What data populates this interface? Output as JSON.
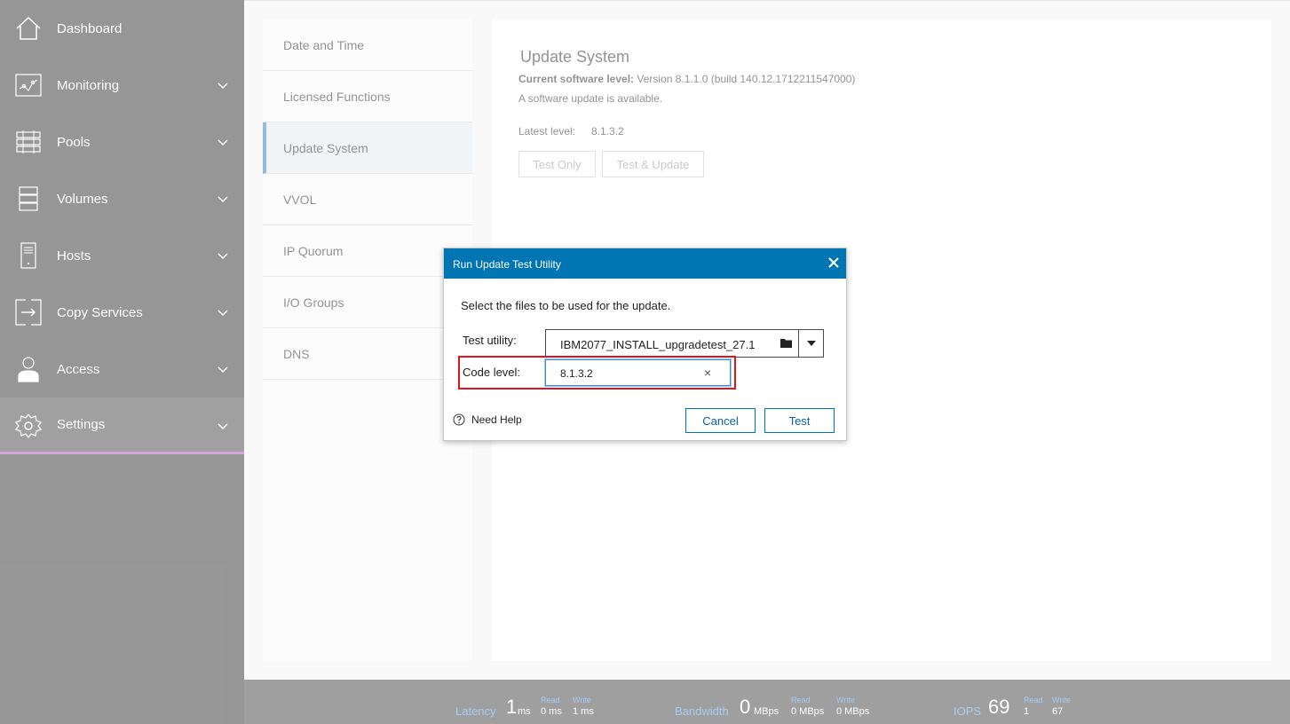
{
  "sidebar": {
    "items": [
      {
        "label": "Dashboard",
        "icon": "home-icon"
      },
      {
        "label": "Monitoring",
        "icon": "monitoring-icon"
      },
      {
        "label": "Pools",
        "icon": "pools-icon"
      },
      {
        "label": "Volumes",
        "icon": "volumes-icon"
      },
      {
        "label": "Hosts",
        "icon": "hosts-icon"
      },
      {
        "label": "Copy Services",
        "icon": "copy-services-icon"
      },
      {
        "label": "Access",
        "icon": "access-icon"
      },
      {
        "label": "Settings",
        "icon": "gear-icon"
      }
    ],
    "active": "Settings"
  },
  "settings_nav": {
    "items": [
      {
        "label": "Date and Time"
      },
      {
        "label": "Licensed Functions"
      },
      {
        "label": "Update System"
      },
      {
        "label": "VVOL"
      },
      {
        "label": "IP Quorum"
      },
      {
        "label": "I/O Groups"
      },
      {
        "label": "DNS"
      }
    ],
    "active": "Update System"
  },
  "update_system": {
    "title": "Update System",
    "current_label": "Current software level:",
    "current_value": "Version 8.1.1.0 (build 140.12.1712211547000)",
    "available_text": "A software update is available.",
    "latest_label": "Latest level:",
    "latest_value": "8.1.3.2",
    "test_only_label": "Test Only",
    "test_update_label": "Test & Update"
  },
  "dialog": {
    "title": "Run Update Test Utility",
    "prompt": "Select the files to be used for the update.",
    "test_utility_label": "Test utility:",
    "test_utility_file": "IBM2077_INSTALL_upgradetest_27.1",
    "code_level_label": "Code level:",
    "code_level_value": "8.1.3.2",
    "clear_symbol": "×",
    "help_text": "Need Help",
    "cancel_label": "Cancel",
    "test_label": "Test"
  },
  "statusbar": {
    "latency": {
      "label": "Latency",
      "value": "1",
      "unit": "ms",
      "read_label": "Read",
      "read_value": "0 ms",
      "write_label": "Write",
      "write_value": "1 ms"
    },
    "bandwidth": {
      "label": "Bandwidth",
      "value": "0",
      "unit": "MBps",
      "read_label": "Read",
      "read_value": "0 MBps",
      "write_label": "Write",
      "write_value": "0 MBps"
    },
    "iops": {
      "label": "IOPS",
      "value": "69",
      "read_label": "Read",
      "read_value": "1",
      "write_label": "Write",
      "write_value": "67"
    }
  },
  "colors": {
    "sidebar_bg": "#3a3a3a",
    "active_accent": "#b556c9",
    "dialog_header": "#0075b4",
    "highlight": "#e0141e",
    "stat_label": "#5aa0e8"
  }
}
